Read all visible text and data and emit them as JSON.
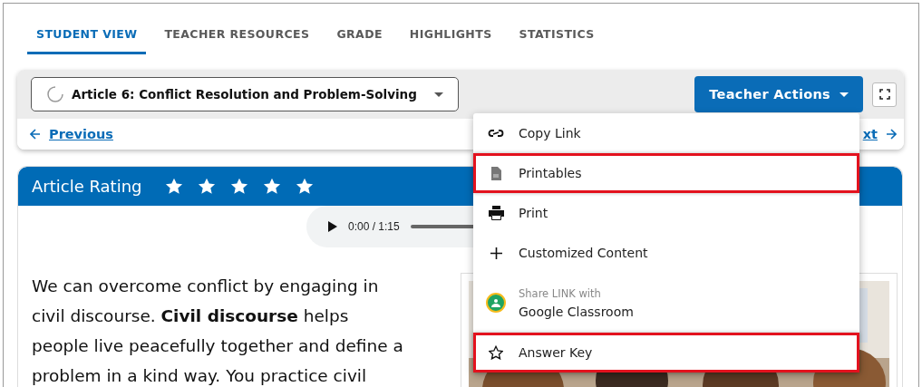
{
  "tabs": [
    {
      "label": "STUDENT VIEW",
      "selected": true
    },
    {
      "label": "TEACHER RESOURCES",
      "selected": false
    },
    {
      "label": "GRADE",
      "selected": false
    },
    {
      "label": "HIGHLIGHTS",
      "selected": false
    },
    {
      "label": "STATISTICS",
      "selected": false
    }
  ],
  "toolbar": {
    "article_select": {
      "value": "Article 6: Conflict Resolution and Problem-Solving"
    },
    "teacher_actions": "Teacher Actions"
  },
  "navigation": {
    "previous": "Previous",
    "next": "xt"
  },
  "article": {
    "rating_label": "Article Rating",
    "stars": 5,
    "audio": {
      "time": "0:00 / 1:15"
    },
    "paragraph": "We can overcome conflict by engaging in civil discourse. **Civil discourse** helps people live peacefully together and define a problem in a kind way. You practice civil"
  },
  "menu": [
    {
      "kind": "action",
      "label": "Copy Link",
      "highlighted": false
    },
    {
      "kind": "action",
      "label": "Printables",
      "highlighted": true
    },
    {
      "kind": "action",
      "label": "Print",
      "highlighted": false
    },
    {
      "kind": "action",
      "label": "Customized Content",
      "highlighted": false
    },
    {
      "kind": "share",
      "caption": "Share LINK with",
      "label": "Google Classroom",
      "highlighted": false
    },
    {
      "kind": "action",
      "label": "Answer Key",
      "highlighted": true
    }
  ]
}
